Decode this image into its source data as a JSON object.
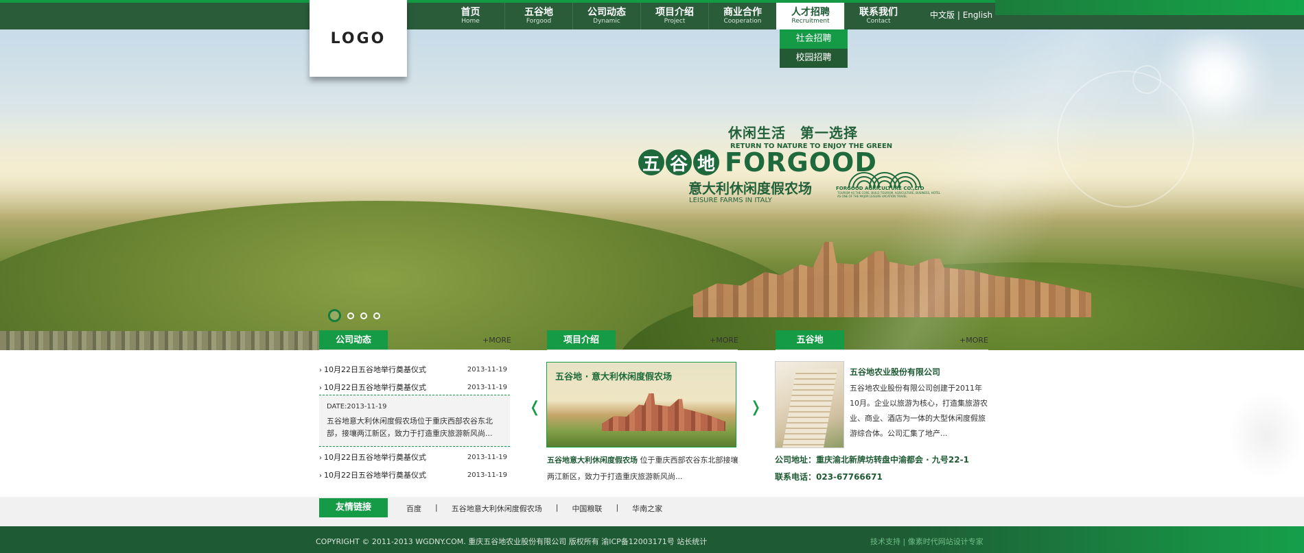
{
  "logo": {
    "text": "LOGO"
  },
  "nav": {
    "items": [
      {
        "zh": "首页",
        "en": "Home"
      },
      {
        "zh": "五谷地",
        "en": "Forgood"
      },
      {
        "zh": "公司动态",
        "en": "Dynamic"
      },
      {
        "zh": "项目介绍",
        "en": "Project"
      },
      {
        "zh": "商业合作",
        "en": "Cooperation"
      },
      {
        "zh": "人才招聘",
        "en": "Recruitment"
      },
      {
        "zh": "联系我们",
        "en": "Contact"
      }
    ],
    "active_index": 5,
    "lang_zh": "中文版",
    "lang_sep": "|",
    "lang_en": "English",
    "dropdown": [
      "社会招聘",
      "校园招聘"
    ]
  },
  "hero": {
    "slogan": "休闲生活　第一选择",
    "slogan_en": "RETURN TO NATURE TO ENJOY THE GREEN",
    "brand_chars": [
      "五",
      "谷",
      "地"
    ],
    "brand_en": "FORGOOD",
    "subtitle": "意大利休闲度假农场",
    "subtitle_en": "LEISURE FARMS IN ITALY",
    "company_en": "FORGOOD AGRICULTURE CO.,LTD",
    "company_tagline": "TOURISM AS THE CORE, BUILD TOURISM, AGRICULTURE, BUSINESS, HOTEL AS ONE OF THE MAJOR LEISURE VACATION TRAVEL",
    "slides": 4,
    "active_slide": 0
  },
  "news": {
    "tab": "公司动态",
    "more": "+MORE",
    "items_top": [
      {
        "title": "10月22日五谷地举行奠基仪式",
        "date": "2013-11-19"
      },
      {
        "title": "10月22日五谷地举行奠基仪式",
        "date": "2013-11-19"
      }
    ],
    "featured": {
      "date": "DATE:2013-11-19",
      "text": "五谷地意大利休闲度假农场位于重庆西部农谷东北部，接壤两江新区，致力于打造重庆旅游新风尚..."
    },
    "items_bottom": [
      {
        "title": "10月22日五谷地举行奠基仪式",
        "date": "2013-11-19"
      },
      {
        "title": "10月22日五谷地举行奠基仪式",
        "date": "2013-11-19"
      }
    ]
  },
  "project": {
    "tab": "项目介绍",
    "more": "+MORE",
    "image_title": "五谷地 · 意大利休闲度假农场",
    "prev": "❬",
    "next": "❭",
    "desc_title": "五谷地意大利休闲度假农场",
    "desc_text": " 位于重庆西部农谷东北部接壤两江新区，致力于打造重庆旅游新风尚..."
  },
  "forgood": {
    "tab": "五谷地",
    "more": "+MORE",
    "company": "五谷地农业股份有限公司",
    "text": "五谷地农业股份有限公司创建于2011年10月。企业以旅游为核心，打造集旅游农业、商业、酒店为一体的大型休闲度假旅游综合体。公司汇集了地产...",
    "address": "公司地址：重庆渝北新牌坊转盘中渝都会 · 九号22-1",
    "phone": "联系电话：023-67766671"
  },
  "links": {
    "tab": "友情链接",
    "items": [
      "百度",
      "五谷地意大利休闲度假农场",
      "中国粮联",
      "华南之家"
    ],
    "separator": "|"
  },
  "footer": {
    "copyright": "COPYRIGHT © 2011-2013 WGDNY.COM. 重庆五谷地农业股份有限公司  版权所有    渝ICP备12003171号    站长统计",
    "credit": "技术支持 | 像素时代网站设计专家"
  },
  "colors": {
    "primary": "#159a46",
    "dark": "#1e5a33",
    "topbar": "#2a5c3a"
  }
}
